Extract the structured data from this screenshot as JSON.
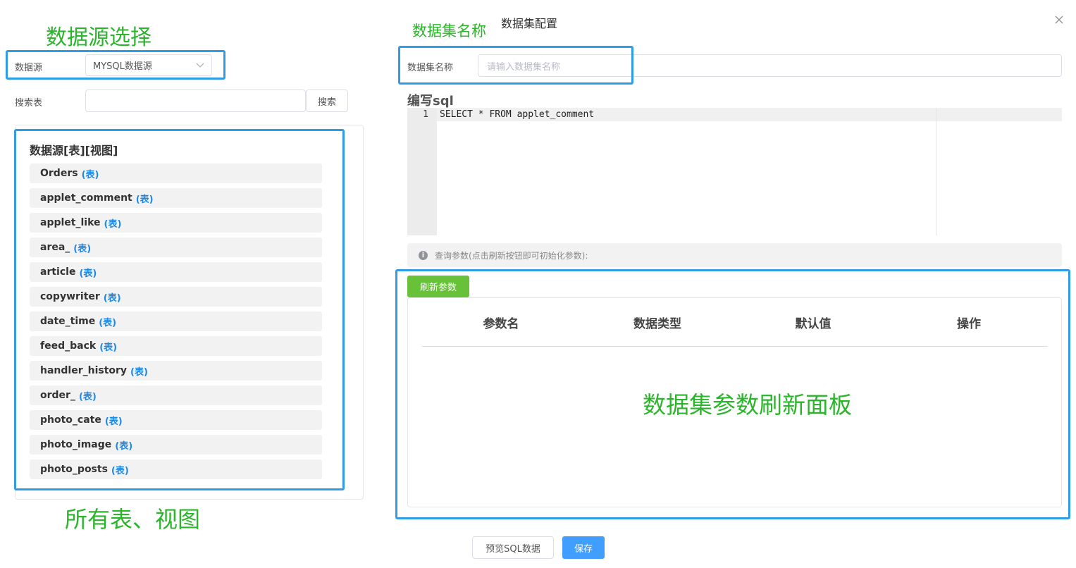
{
  "annotations": {
    "datasource_select": "数据源选择",
    "all_tables_views": "所有表、视图",
    "dataset_name": "数据集名称",
    "params_panel": "数据集参数刷新面板"
  },
  "left": {
    "datasource_label": "数据源",
    "datasource_value": "MYSQL数据源",
    "search_label": "搜索表",
    "search_value": "",
    "search_button": "搜索",
    "tree_title": "数据源[表][视图]",
    "tables": [
      {
        "name": "Orders",
        "tag": "(表)"
      },
      {
        "name": "applet_comment",
        "tag": "(表)"
      },
      {
        "name": "applet_like",
        "tag": "(表)"
      },
      {
        "name": "area_",
        "tag": "(表)"
      },
      {
        "name": "article",
        "tag": "(表)"
      },
      {
        "name": "copywriter",
        "tag": "(表)"
      },
      {
        "name": "date_time",
        "tag": "(表)"
      },
      {
        "name": "feed_back",
        "tag": "(表)"
      },
      {
        "name": "handler_history",
        "tag": "(表)"
      },
      {
        "name": "order_",
        "tag": "(表)"
      },
      {
        "name": "photo_cate",
        "tag": "(表)"
      },
      {
        "name": "photo_image",
        "tag": "(表)"
      },
      {
        "name": "photo_posts",
        "tag": "(表)"
      }
    ]
  },
  "dialog": {
    "title": "数据集配置",
    "close_icon": "×",
    "name_label": "数据集名称",
    "name_placeholder": "请输入数据集名称",
    "sql_title": "编写sql",
    "sql_lines": [
      {
        "num": "1",
        "code": "SELECT * FROM applet_comment"
      }
    ],
    "info_icon": "i",
    "info_text": "查询参数(点击刷新按钮即可初始化参数):",
    "refresh_button": "刷新参数",
    "table_headers": [
      "参数名",
      "数据类型",
      "默认值",
      "操作"
    ],
    "preview_button": "预览SQL数据",
    "save_button": "保存"
  },
  "colors": {
    "annotation_green": "#2bb52b",
    "annotation_blue": "#2e9ce6",
    "primary": "#409eff",
    "success": "#67c23a",
    "tag_blue": "#1e88e5"
  }
}
